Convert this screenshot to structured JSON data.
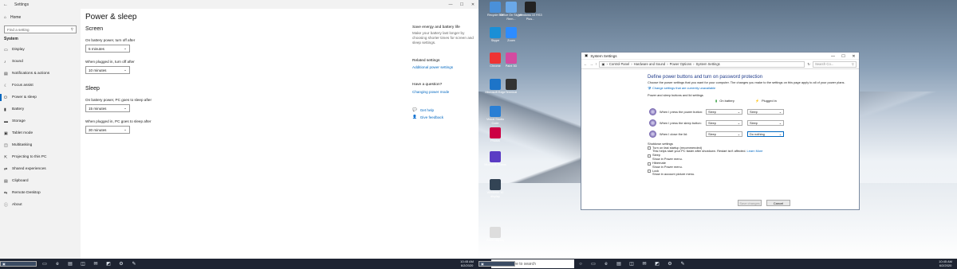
{
  "settings": {
    "app_title": "Settings",
    "home": "Home",
    "search_placeholder": "Find a setting",
    "section": "System",
    "nav_items": [
      "Display",
      "Sound",
      "Notifications & actions",
      "Focus assist",
      "Power & sleep",
      "Battery",
      "Storage",
      "Tablet mode",
      "Multitasking",
      "Projecting to this PC",
      "Shared experiences",
      "Clipboard",
      "Remote Desktop",
      "About"
    ],
    "active_item": "Power & sleep",
    "page_title": "Power & sleep",
    "screen_heading": "Screen",
    "screen_battery_label": "On battery power, turn off after",
    "screen_battery_value": "5 minutes",
    "screen_plugged_label": "When plugged in, turn off after",
    "screen_plugged_value": "10 minutes",
    "sleep_heading": "Sleep",
    "sleep_battery_label": "On battery power, PC goes to sleep after",
    "sleep_battery_value": "15 minutes",
    "sleep_plugged_label": "When plugged in, PC goes to sleep after",
    "sleep_plugged_value": "30 minutes",
    "side_title": "Save energy and battery life",
    "side_desc": "Make your battery last longer by choosing shorter times for screen and sleep settings.",
    "related_title": "Related settings",
    "related_link": "Additional power settings",
    "question_title": "Have a question?",
    "question_link": "Changing power mode",
    "get_help": "Get help",
    "give_feedback": "Give feedback"
  },
  "taskbar_left": {
    "time": "10:45 AM",
    "date": "6/2/2020"
  },
  "taskbar_right": {
    "search_placeholder": "Type here to search",
    "time": "10:45 AM",
    "date": "6/2/2020"
  },
  "desktop_icons": [
    "Recycle Bin",
    "Office On Skype Rem...",
    "Windows 10 RS3 Plus...",
    "Skype",
    "Zoom",
    "Chrome",
    "Paint 3D",
    "Terminal",
    "Microsoft Edge",
    "Visual Studio Code",
    "Photos",
    "Microsoft Teams",
    "Windows 10 display",
    "Zoom display"
  ],
  "sys_window": {
    "title": "System Settings",
    "breadcrumb": [
      "Control Panel",
      "Hardware and Sound",
      "Power Options",
      "System Settings"
    ],
    "search_placeholder": "Search Co...",
    "heading": "Define power buttons and turn on password protection",
    "description": "Choose the power settings that you want for your computer. The changes you make to the settings on this page apply to all of your power plans.",
    "change_link": "Change settings that are currently unavailable",
    "buttons_section": "Power and sleep buttons and lid settings",
    "col_battery": "On battery",
    "col_plugged": "Plugged in",
    "rows": [
      {
        "label": "When I press the power button:",
        "battery": "Sleep",
        "plugged": "Sleep"
      },
      {
        "label": "When I press the sleep button:",
        "battery": "Sleep",
        "plugged": "Sleep"
      },
      {
        "label": "When I close the lid:",
        "battery": "Sleep",
        "plugged": "Do nothing"
      }
    ],
    "shutdown_title": "Shutdown settings",
    "fast_startup": "Turn on fast startup (recommended)",
    "fast_startup_desc": "This helps start your PC faster after shutdown. Restart isn't affected.",
    "learn_more": "Learn More",
    "sleep_opt": "Sleep",
    "sleep_opt_desc": "Show in Power menu.",
    "hibernate_opt": "Hibernate",
    "hibernate_opt_desc": "Show in Power menu.",
    "lock_opt": "Lock",
    "lock_opt_desc": "Show in account picture menu.",
    "save_button": "Save changes",
    "cancel_button": "Cancel"
  },
  "colors": {
    "accent": "#0067c0",
    "taskbar": "#1e2432",
    "nav_bg": "#f2f2f2"
  }
}
